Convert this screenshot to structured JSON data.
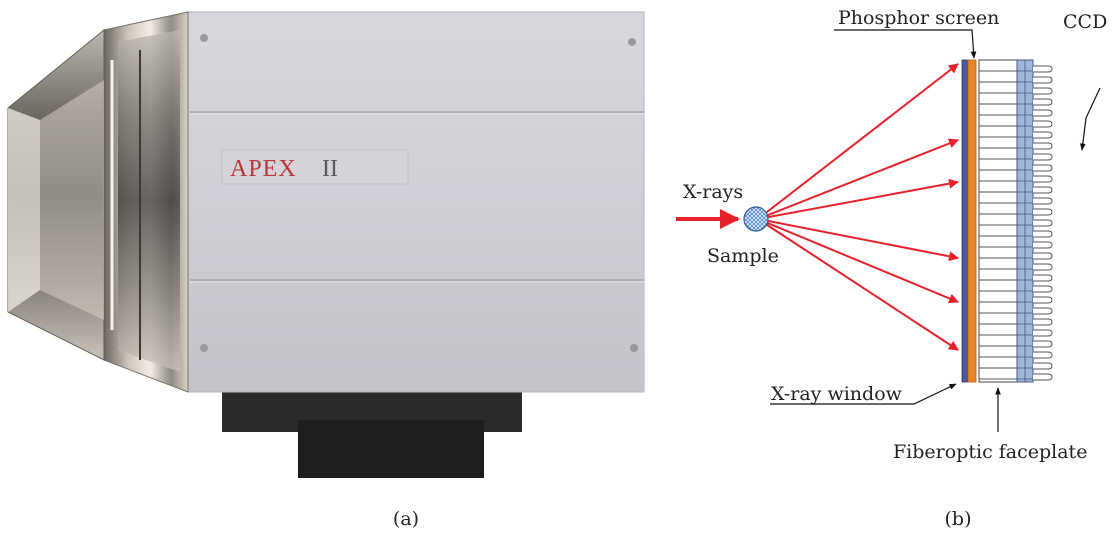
{
  "figure": {
    "panel_a_caption": "(a)",
    "panel_b_caption": "(b)"
  },
  "photo": {
    "brand_text": "APEX",
    "model_text": "II",
    "brand_color": "#b8383c"
  },
  "diagram": {
    "labels": {
      "phosphor_screen": "Phosphor screen",
      "ccd": "CCD",
      "xrays": "X-rays",
      "sample": "Sample",
      "xray_window": "X-ray window",
      "fiberoptic_faceplate": "Fiberoptic faceplate"
    },
    "colors": {
      "ray": "#e8202a",
      "window": "#4a5a9a",
      "phosphor": "#e8852a",
      "ccd": "#9fb7d9",
      "sample": "#4e86c9"
    }
  }
}
